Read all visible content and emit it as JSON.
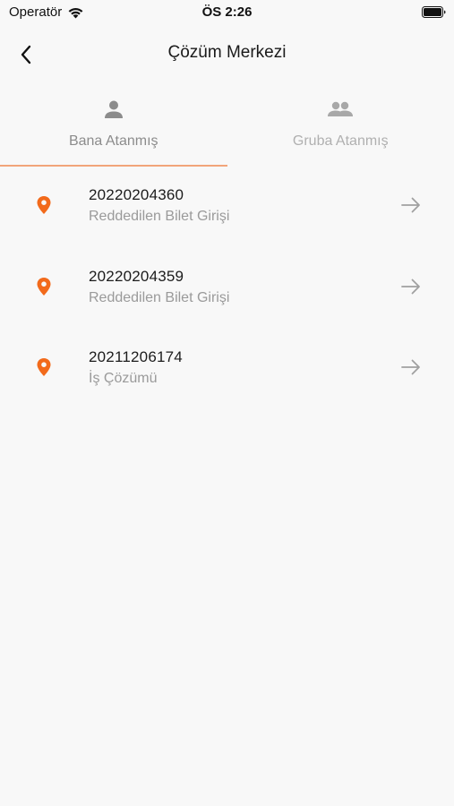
{
  "status_bar": {
    "carrier": "Operatör",
    "time": "ÖS 2:26",
    "wifi_icon": "wifi-icon",
    "battery_icon": "battery-icon"
  },
  "nav": {
    "title": "Çözüm Merkezi",
    "back_icon": "chevron-left-icon"
  },
  "tabs": [
    {
      "label": "Bana Atanmış",
      "icon": "person-icon",
      "selected": true
    },
    {
      "label": "Gruba Atanmış",
      "icon": "group-icon",
      "selected": false
    }
  ],
  "items": [
    {
      "number": "20220204360",
      "type": "Reddedilen Bilet Girişi"
    },
    {
      "number": "20220204359",
      "type": "Reddedilen Bilet Girişi"
    },
    {
      "number": "20211206174",
      "type": "İş Çözümü"
    }
  ],
  "colors": {
    "accent": "#f26a1b",
    "underline": "#f2a57a",
    "background": "#f8f8f8",
    "muted_text": "#9a9a9a"
  }
}
